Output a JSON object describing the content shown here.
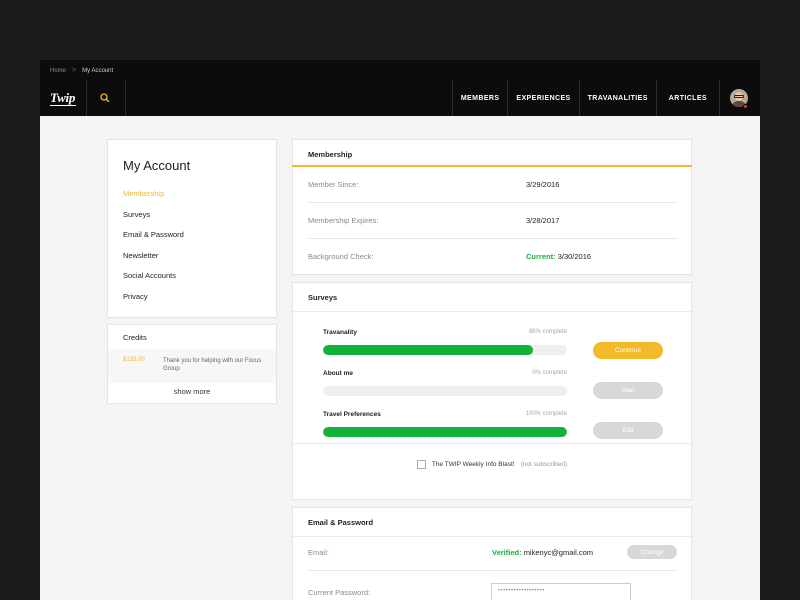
{
  "breadcrumb": {
    "home": "Home",
    "separator": ">",
    "current": "My Account"
  },
  "brand": {
    "logo_text": "Twip"
  },
  "header": {
    "search_icon": "search-icon",
    "nav": [
      "MEMBERS",
      "EXPERIENCES",
      "TRAVANALITIES",
      "ARTICLES"
    ],
    "avatar_status": "notification-dot"
  },
  "sidebar": {
    "title": "My Account",
    "items": [
      {
        "label": "Membership",
        "active": true
      },
      {
        "label": "Surveys",
        "active": false
      },
      {
        "label": "Email & Password",
        "active": false
      },
      {
        "label": "Newsletter",
        "active": false
      },
      {
        "label": "Social Accounts",
        "active": false
      },
      {
        "label": "Privacy",
        "active": false
      }
    ]
  },
  "credits": {
    "title": "Credits",
    "entries": [
      {
        "amount": "$125.00",
        "note": "Thank you for helping with our Focus Group"
      }
    ],
    "show_more": "show more"
  },
  "membership": {
    "title": "Membership",
    "rows": [
      {
        "label": "Member Since:",
        "value": "3/29/2016"
      },
      {
        "label": "Membership Expires:",
        "value": "3/28/2017"
      },
      {
        "label": "Background Check:",
        "status": "Current:",
        "value": "3/30/2016"
      }
    ]
  },
  "surveys": {
    "title": "Surveys",
    "items": [
      {
        "name": "Travanality",
        "progress_text": "86% complete",
        "progress": 0.86,
        "action": "Continue",
        "action_state": "primary"
      },
      {
        "name": "About me",
        "progress_text": "0% complete",
        "progress": 0.0,
        "action": "Start",
        "action_state": "disabled"
      },
      {
        "name": "Travel Preferences",
        "progress_text": "100% complete",
        "progress": 1.0,
        "action": "Edit",
        "action_state": "disabled"
      }
    ],
    "newsletter_label": "The TWIP Weekly Info Blast!",
    "newsletter_status": "(not subscribed)"
  },
  "email_password": {
    "title": "Email & Password",
    "email_label": "Email:",
    "email_status": "Verified:",
    "email_value": "mikenyc@gmail.com",
    "change_label": "Change",
    "password_label": "Current Password:",
    "password_value": "••••••••••••••••••"
  },
  "colors": {
    "accent": "#f2b928",
    "success": "#12b23a",
    "topbar": "#0c0c0c",
    "disabled": "#d8d8d8"
  }
}
